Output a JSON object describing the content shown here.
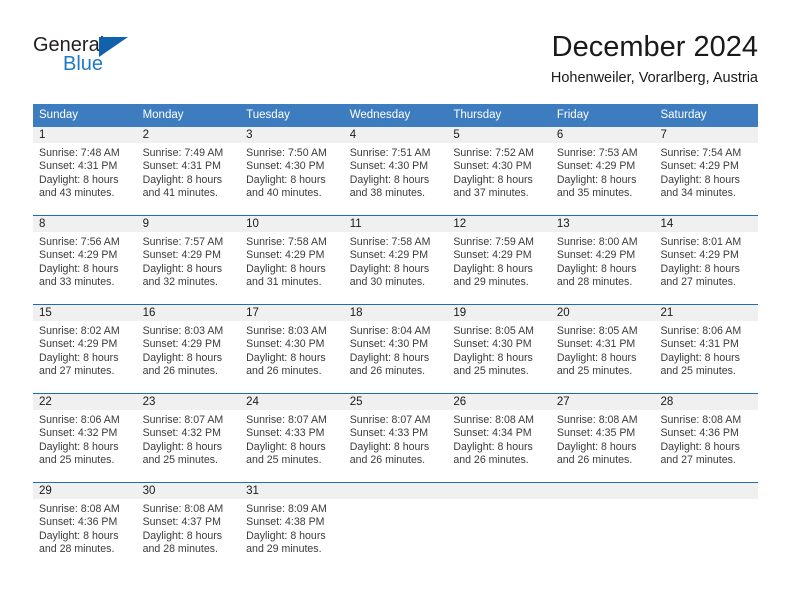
{
  "brand": {
    "name_top": "General",
    "name_bottom": "Blue",
    "triangle_color": "#1162AB",
    "blue_text_color": "#1F7AC4"
  },
  "header": {
    "title": "December 2024",
    "subtitle": "Hohenweiler, Vorarlberg, Austria"
  },
  "theme": {
    "header_bg": "#3D7DBF",
    "header_text": "#FFFFFF",
    "row_divider": "#1F6CB0",
    "day_number_bg": "#F0F0F0"
  },
  "weekdays": [
    "Sunday",
    "Monday",
    "Tuesday",
    "Wednesday",
    "Thursday",
    "Friday",
    "Saturday"
  ],
  "weeks": [
    [
      {
        "day": "1",
        "lines": [
          "Sunrise: 7:48 AM",
          "Sunset: 4:31 PM",
          "Daylight: 8 hours",
          "and 43 minutes."
        ]
      },
      {
        "day": "2",
        "lines": [
          "Sunrise: 7:49 AM",
          "Sunset: 4:31 PM",
          "Daylight: 8 hours",
          "and 41 minutes."
        ]
      },
      {
        "day": "3",
        "lines": [
          "Sunrise: 7:50 AM",
          "Sunset: 4:30 PM",
          "Daylight: 8 hours",
          "and 40 minutes."
        ]
      },
      {
        "day": "4",
        "lines": [
          "Sunrise: 7:51 AM",
          "Sunset: 4:30 PM",
          "Daylight: 8 hours",
          "and 38 minutes."
        ]
      },
      {
        "day": "5",
        "lines": [
          "Sunrise: 7:52 AM",
          "Sunset: 4:30 PM",
          "Daylight: 8 hours",
          "and 37 minutes."
        ]
      },
      {
        "day": "6",
        "lines": [
          "Sunrise: 7:53 AM",
          "Sunset: 4:29 PM",
          "Daylight: 8 hours",
          "and 35 minutes."
        ]
      },
      {
        "day": "7",
        "lines": [
          "Sunrise: 7:54 AM",
          "Sunset: 4:29 PM",
          "Daylight: 8 hours",
          "and 34 minutes."
        ]
      }
    ],
    [
      {
        "day": "8",
        "lines": [
          "Sunrise: 7:56 AM",
          "Sunset: 4:29 PM",
          "Daylight: 8 hours",
          "and 33 minutes."
        ]
      },
      {
        "day": "9",
        "lines": [
          "Sunrise: 7:57 AM",
          "Sunset: 4:29 PM",
          "Daylight: 8 hours",
          "and 32 minutes."
        ]
      },
      {
        "day": "10",
        "lines": [
          "Sunrise: 7:58 AM",
          "Sunset: 4:29 PM",
          "Daylight: 8 hours",
          "and 31 minutes."
        ]
      },
      {
        "day": "11",
        "lines": [
          "Sunrise: 7:58 AM",
          "Sunset: 4:29 PM",
          "Daylight: 8 hours",
          "and 30 minutes."
        ]
      },
      {
        "day": "12",
        "lines": [
          "Sunrise: 7:59 AM",
          "Sunset: 4:29 PM",
          "Daylight: 8 hours",
          "and 29 minutes."
        ]
      },
      {
        "day": "13",
        "lines": [
          "Sunrise: 8:00 AM",
          "Sunset: 4:29 PM",
          "Daylight: 8 hours",
          "and 28 minutes."
        ]
      },
      {
        "day": "14",
        "lines": [
          "Sunrise: 8:01 AM",
          "Sunset: 4:29 PM",
          "Daylight: 8 hours",
          "and 27 minutes."
        ]
      }
    ],
    [
      {
        "day": "15",
        "lines": [
          "Sunrise: 8:02 AM",
          "Sunset: 4:29 PM",
          "Daylight: 8 hours",
          "and 27 minutes."
        ]
      },
      {
        "day": "16",
        "lines": [
          "Sunrise: 8:03 AM",
          "Sunset: 4:29 PM",
          "Daylight: 8 hours",
          "and 26 minutes."
        ]
      },
      {
        "day": "17",
        "lines": [
          "Sunrise: 8:03 AM",
          "Sunset: 4:30 PM",
          "Daylight: 8 hours",
          "and 26 minutes."
        ]
      },
      {
        "day": "18",
        "lines": [
          "Sunrise: 8:04 AM",
          "Sunset: 4:30 PM",
          "Daylight: 8 hours",
          "and 26 minutes."
        ]
      },
      {
        "day": "19",
        "lines": [
          "Sunrise: 8:05 AM",
          "Sunset: 4:30 PM",
          "Daylight: 8 hours",
          "and 25 minutes."
        ]
      },
      {
        "day": "20",
        "lines": [
          "Sunrise: 8:05 AM",
          "Sunset: 4:31 PM",
          "Daylight: 8 hours",
          "and 25 minutes."
        ]
      },
      {
        "day": "21",
        "lines": [
          "Sunrise: 8:06 AM",
          "Sunset: 4:31 PM",
          "Daylight: 8 hours",
          "and 25 minutes."
        ]
      }
    ],
    [
      {
        "day": "22",
        "lines": [
          "Sunrise: 8:06 AM",
          "Sunset: 4:32 PM",
          "Daylight: 8 hours",
          "and 25 minutes."
        ]
      },
      {
        "day": "23",
        "lines": [
          "Sunrise: 8:07 AM",
          "Sunset: 4:32 PM",
          "Daylight: 8 hours",
          "and 25 minutes."
        ]
      },
      {
        "day": "24",
        "lines": [
          "Sunrise: 8:07 AM",
          "Sunset: 4:33 PM",
          "Daylight: 8 hours",
          "and 25 minutes."
        ]
      },
      {
        "day": "25",
        "lines": [
          "Sunrise: 8:07 AM",
          "Sunset: 4:33 PM",
          "Daylight: 8 hours",
          "and 26 minutes."
        ]
      },
      {
        "day": "26",
        "lines": [
          "Sunrise: 8:08 AM",
          "Sunset: 4:34 PM",
          "Daylight: 8 hours",
          "and 26 minutes."
        ]
      },
      {
        "day": "27",
        "lines": [
          "Sunrise: 8:08 AM",
          "Sunset: 4:35 PM",
          "Daylight: 8 hours",
          "and 26 minutes."
        ]
      },
      {
        "day": "28",
        "lines": [
          "Sunrise: 8:08 AM",
          "Sunset: 4:36 PM",
          "Daylight: 8 hours",
          "and 27 minutes."
        ]
      }
    ],
    [
      {
        "day": "29",
        "lines": [
          "Sunrise: 8:08 AM",
          "Sunset: 4:36 PM",
          "Daylight: 8 hours",
          "and 28 minutes."
        ]
      },
      {
        "day": "30",
        "lines": [
          "Sunrise: 8:08 AM",
          "Sunset: 4:37 PM",
          "Daylight: 8 hours",
          "and 28 minutes."
        ]
      },
      {
        "day": "31",
        "lines": [
          "Sunrise: 8:09 AM",
          "Sunset: 4:38 PM",
          "Daylight: 8 hours",
          "and 29 minutes."
        ]
      },
      {
        "day": "",
        "lines": []
      },
      {
        "day": "",
        "lines": []
      },
      {
        "day": "",
        "lines": []
      },
      {
        "day": "",
        "lines": []
      }
    ]
  ]
}
